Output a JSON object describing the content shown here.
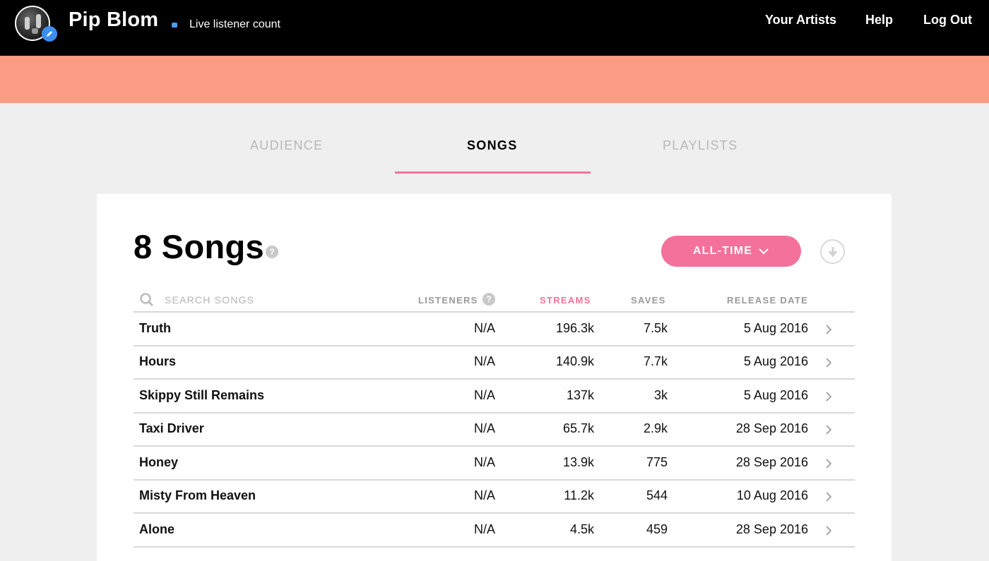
{
  "header": {
    "artist_name": "Pip Blom",
    "live_label": "Live listener count",
    "nav": [
      "Your Artists",
      "Help",
      "Log Out"
    ]
  },
  "tabs": [
    {
      "label": "AUDIENCE",
      "active": false
    },
    {
      "label": "SONGS",
      "active": true
    },
    {
      "label": "PLAYLISTS",
      "active": false
    }
  ],
  "songs_panel": {
    "title": "8 Songs",
    "help_glyph": "?",
    "range_button": "ALL-TIME",
    "search_placeholder": "SEARCH SONGS",
    "columns": {
      "listeners": "LISTENERS",
      "streams": "STREAMS",
      "saves": "SAVES",
      "release_date": "RELEASE DATE"
    },
    "sorted_column": "streams",
    "rows": [
      {
        "name": "Truth",
        "listeners": "N/A",
        "streams": "196.3k",
        "saves": "7.5k",
        "release_date": "5 Aug 2016"
      },
      {
        "name": "Hours",
        "listeners": "N/A",
        "streams": "140.9k",
        "saves": "7.7k",
        "release_date": "5 Aug 2016"
      },
      {
        "name": "Skippy Still Remains",
        "listeners": "N/A",
        "streams": "137k",
        "saves": "3k",
        "release_date": "5 Aug 2016"
      },
      {
        "name": "Taxi Driver",
        "listeners": "N/A",
        "streams": "65.7k",
        "saves": "2.9k",
        "release_date": "28 Sep 2016"
      },
      {
        "name": "Honey",
        "listeners": "N/A",
        "streams": "13.9k",
        "saves": "775",
        "release_date": "28 Sep 2016"
      },
      {
        "name": "Misty From Heaven",
        "listeners": "N/A",
        "streams": "11.2k",
        "saves": "544",
        "release_date": "10 Aug 2016"
      },
      {
        "name": "Alone",
        "listeners": "N/A",
        "streams": "4.5k",
        "saves": "459",
        "release_date": "28 Sep 2016"
      }
    ]
  },
  "colors": {
    "accent_pink": "#f4719c",
    "banner": "#fc9b83",
    "live_dot": "#4b9bf5"
  }
}
